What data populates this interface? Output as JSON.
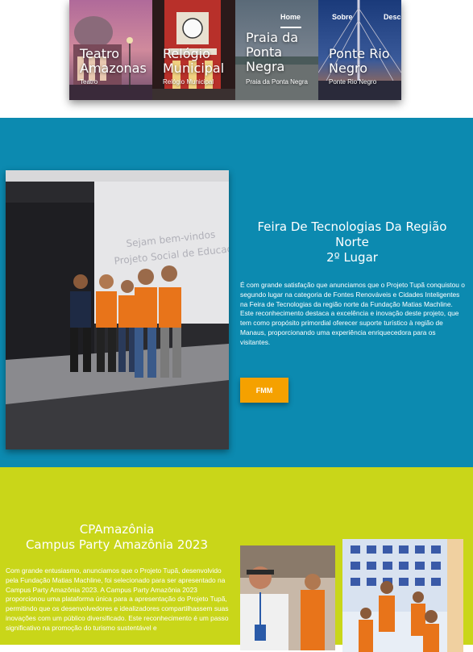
{
  "nav": {
    "home": "Home",
    "sobre": "Sobre",
    "desc": "Desc"
  },
  "gallery": [
    {
      "title": "Teatro Amazonas",
      "subtitle": "Teatro"
    },
    {
      "title": "Relógio Municipal",
      "subtitle": "Relógio Municipal"
    },
    {
      "title": "Praia da Ponta Negra",
      "subtitle": "Praia da Ponta Negra"
    },
    {
      "title": "Ponte Rio Negro",
      "subtitle": "Ponte Rio Negro"
    }
  ],
  "feira": {
    "title_line1": "Feira De Tecnologias Da Região Norte",
    "title_line2": "2º Lugar",
    "body": "É com grande satisfação que anunciamos que o Projeto Tupã conquistou o segundo lugar na categoria de Fontes Renováveis e Cidades Inteligentes na Feira de Tecnologias da região norte da Fundação Matias Machline. Este reconhecimento destaca a excelência e inovação deste projeto, que tem como propósito primordial oferecer suporte turístico à região de Manaus, proporcionando uma experiência enriquecedora para os visitantes.",
    "button": "FMM",
    "slide_text": "Sejam bem-vindos ao Projeto Social de Educação"
  },
  "campus": {
    "title_line1": "CPAmazônia",
    "title_line2": "Campus Party Amazônia 2023",
    "body": "Com grande entusiasmo, anunciamos que o Projeto Tupã, desenvolvido pela Fundação Matias Machline, foi selecionado para ser apresentado na Campus Party Amazônia 2023. A Campus Party Amazônia 2023 proporcionou uma plataforma única para a apresentação do Projeto Tupã, permitindo que os desenvolvedores e idealizadores compartilhassem suas inovações com um público diversificado. Este reconhecimento é um passo significativo na promoção do turismo sustentável e"
  },
  "colors": {
    "blue_section": "#0c8ab0",
    "yellow_section": "#c9d619",
    "button": "#f5a100"
  }
}
